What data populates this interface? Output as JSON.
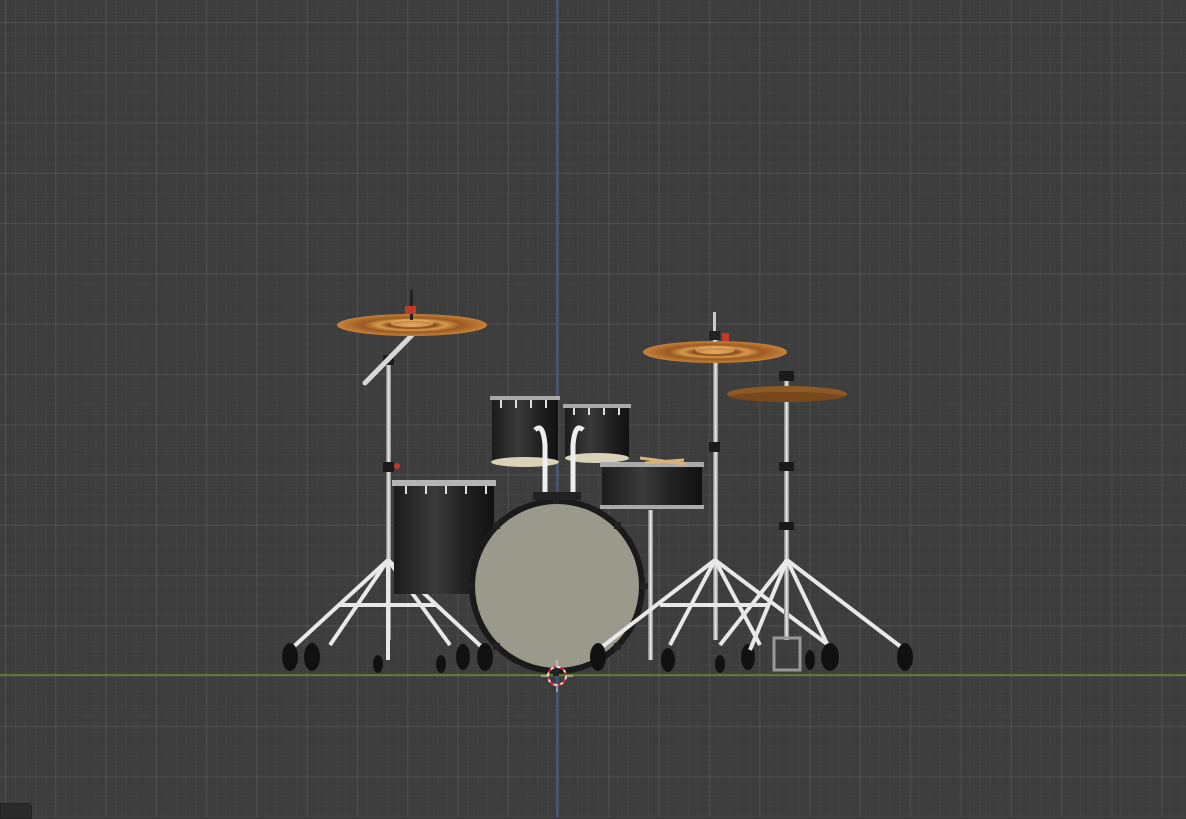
{
  "viewport": {
    "background": "#3d3d3d",
    "grid_color": "#4a4a4a",
    "axis_z_color": "#3a5a8c",
    "axis_x_color": "#5b7d2c"
  },
  "scene": {
    "objects": [
      "drum-kit",
      "crash-cymbal",
      "ride-cymbal",
      "hi-hat",
      "bass-drum",
      "floor-tom",
      "rack-tom-left",
      "rack-tom-right",
      "snare-drum"
    ],
    "cursor_icon": "3d-cursor-icon"
  }
}
